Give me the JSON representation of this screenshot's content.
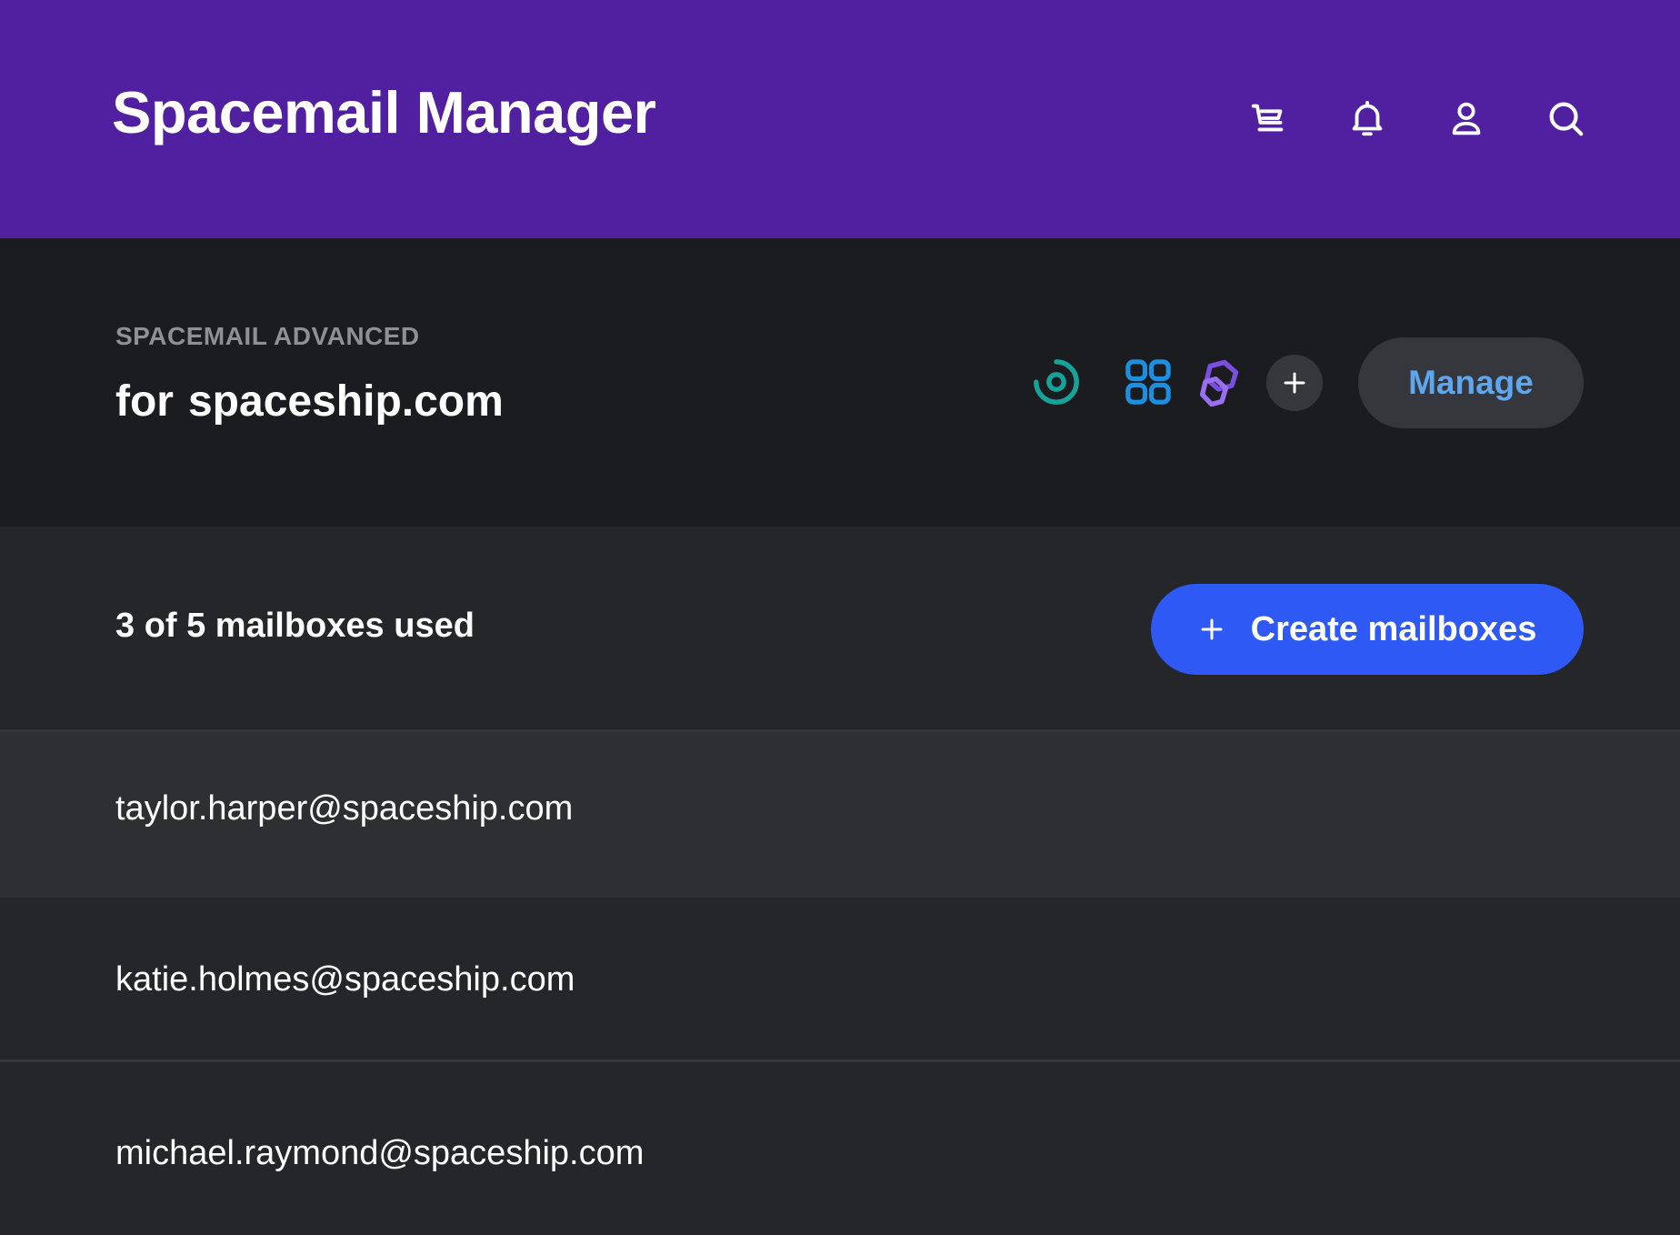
{
  "header": {
    "title": "Spacemail Manager",
    "background": "#5020a0",
    "icons": [
      "cart-icon",
      "bell-icon",
      "user-icon",
      "search-icon"
    ]
  },
  "plan": {
    "label": "SPACEMAIL ADVANCED",
    "for_text": "for",
    "domain": "spaceship.com",
    "apps": [
      "spacemail-app-icon",
      "apps-grid-icon",
      "link-app-icon"
    ],
    "manage_label": "Manage"
  },
  "usage": {
    "text": "3 of 5 mailboxes used",
    "used": 3,
    "total": 5,
    "create_label": "Create mailboxes"
  },
  "mailboxes": [
    {
      "email": "taylor.harper@spaceship.com"
    },
    {
      "email": "katie.holmes@spaceship.com"
    },
    {
      "email": "michael.raymond@spaceship.com"
    }
  ],
  "colors": {
    "accent_blue": "#2f59f5",
    "manage_text": "#5ea7ee",
    "teal_icon": "#15a39a",
    "blue_icon": "#1d8fe0",
    "purple_icon": "#7a4fe0"
  }
}
